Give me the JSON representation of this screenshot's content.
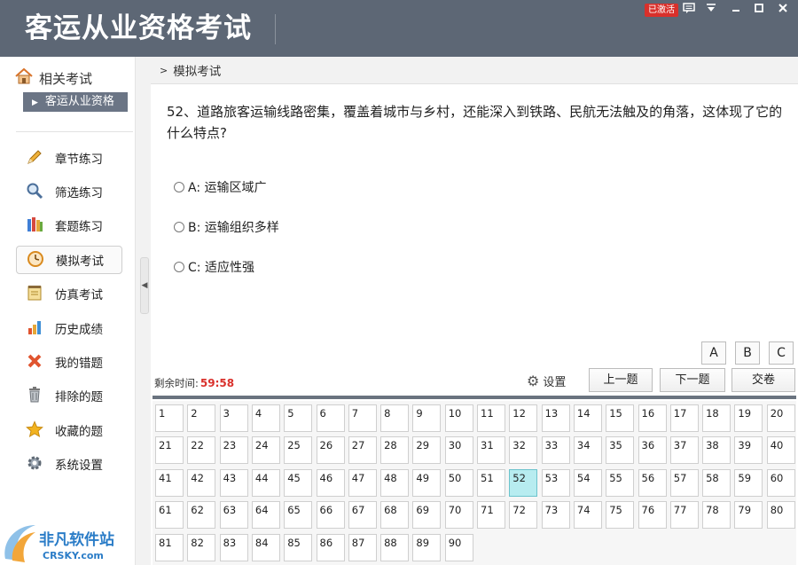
{
  "app": {
    "title": "客运从业资格考试",
    "activated_badge": "已激活",
    "window_controls": [
      "message-icon",
      "menu-icon",
      "minimize-icon",
      "maximize-icon",
      "close-icon"
    ]
  },
  "sidebar": {
    "related_heading": "相关考试",
    "related_item": "客运从业资格",
    "items": [
      {
        "label": "章节练习",
        "icon": "pencil-icon"
      },
      {
        "label": "筛选练习",
        "icon": "magnifier-icon"
      },
      {
        "label": "套题练习",
        "icon": "books-icon"
      },
      {
        "label": "模拟考试",
        "icon": "clock-icon",
        "active": true
      },
      {
        "label": "仿真考试",
        "icon": "notepad-icon"
      },
      {
        "label": "历史成绩",
        "icon": "bar-chart-icon"
      },
      {
        "label": "我的错题",
        "icon": "cross-icon"
      },
      {
        "label": "排除的题",
        "icon": "trash-icon"
      },
      {
        "label": "收藏的题",
        "icon": "star-icon"
      },
      {
        "label": "系统设置",
        "icon": "gear-icon"
      }
    ]
  },
  "watermark": {
    "logo_text": "非凡软件站",
    "logo_sub": "CRSKY.com"
  },
  "breadcrumb": "模拟考试",
  "question": {
    "number": "52",
    "text": "52、道路旅客运输线路密集，覆盖着城市与乡村，还能深入到铁路、民航无法触及的角落，这体现了它的什么特点?",
    "options": [
      {
        "key": "A",
        "label": "A: 运输区域广"
      },
      {
        "key": "B",
        "label": "B: 运输组织多样"
      },
      {
        "key": "C",
        "label": "C: 适应性强"
      }
    ]
  },
  "answer_buttons": [
    "A",
    "B",
    "C"
  ],
  "timer": {
    "label": "剩余时间:",
    "value": "59:58"
  },
  "toolbar": {
    "settings": "设置",
    "prev": "上一题",
    "next": "下一题",
    "submit": "交卷"
  },
  "grid": {
    "numbers": [
      "1",
      "2",
      "3",
      "4",
      "5",
      "6",
      "7",
      "8",
      "9",
      "10",
      "11",
      "12",
      "13",
      "14",
      "15",
      "16",
      "17",
      "18",
      "19",
      "20",
      "21",
      "22",
      "23",
      "24",
      "25",
      "26",
      "27",
      "28",
      "29",
      "30",
      "31",
      "32",
      "33",
      "34",
      "35",
      "36",
      "37",
      "38",
      "39",
      "40",
      "41",
      "42",
      "43",
      "44",
      "45",
      "46",
      "47",
      "48",
      "49",
      "50",
      "51",
      "52",
      "53",
      "54",
      "55",
      "56",
      "57",
      "58",
      "59",
      "60",
      "61",
      "62",
      "63",
      "64",
      "65",
      "66",
      "67",
      "68",
      "69",
      "70",
      "71",
      "72",
      "73",
      "74",
      "75",
      "76",
      "77",
      "78",
      "79",
      "80",
      "81",
      "82",
      "83",
      "84",
      "85",
      "86",
      "87",
      "88",
      "89",
      "90"
    ],
    "current": "52"
  },
  "colors": {
    "titlebar": "#5d6775",
    "accent_red": "#d9302b",
    "current_cell": "#b7ecf0"
  }
}
